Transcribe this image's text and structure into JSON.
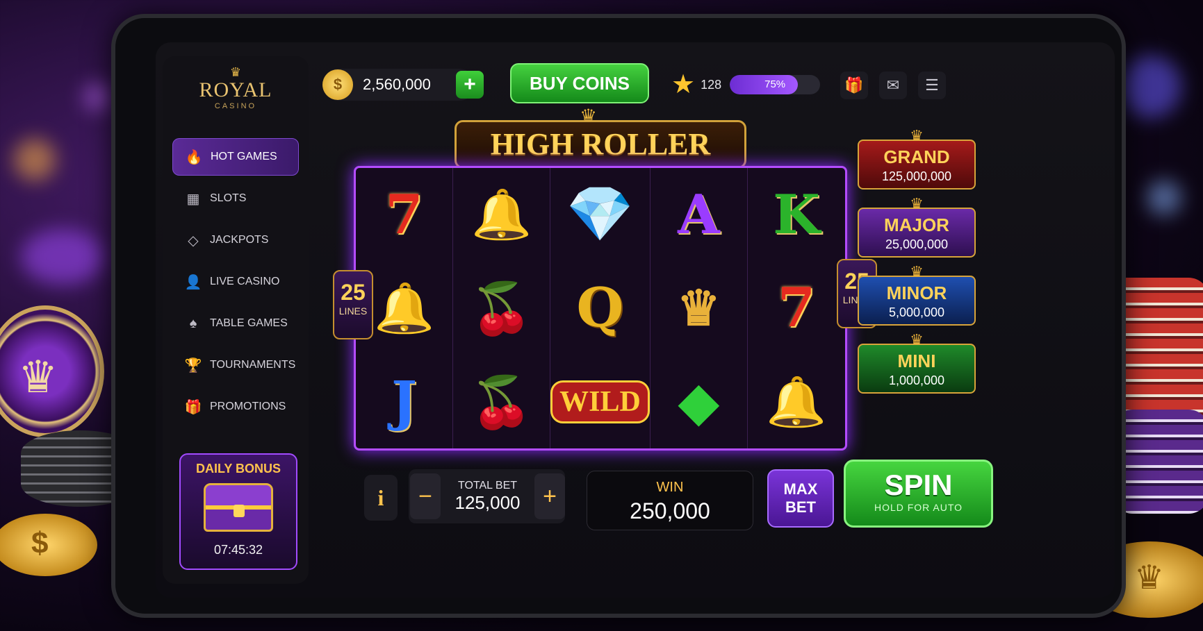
{
  "sidebar": {
    "logo": {
      "brand": "ROYAL",
      "sub": "CASINO"
    },
    "items": [
      {
        "label": "HOT GAMES",
        "icon": "flame-icon",
        "active": true
      },
      {
        "label": "SLOTS",
        "icon": "slot-machine-icon"
      },
      {
        "label": "JACKPOTS",
        "icon": "diamond-icon"
      },
      {
        "label": "LIVE CASINO",
        "icon": "person-icon"
      },
      {
        "label": "TABLE GAMES",
        "icon": "spade-icon"
      },
      {
        "label": "TOURNAMENTS",
        "icon": "trophy-icon"
      },
      {
        "label": "PROMOTIONS",
        "icon": "gift-icon"
      }
    ],
    "daily_bonus": {
      "title": "DAILY BONUS",
      "timer": "07:45:32"
    }
  },
  "topbar": {
    "coins": "2,560,000",
    "buy_coins": "BUY COINS",
    "level": "128",
    "xp_percent_label": "75%",
    "xp_fraction": 0.75
  },
  "game": {
    "title": "HIGH ROLLER",
    "lines_left": {
      "n": "25",
      "t": "LINES"
    },
    "lines_right": {
      "n": "25",
      "t": "LINES"
    },
    "reels": [
      [
        "7",
        "bell",
        "diamond",
        "A",
        "K"
      ],
      [
        "bell-dollar",
        "cherry",
        "Q",
        "crown",
        "7"
      ],
      [
        "J",
        "cherry",
        "WILD",
        "emerald",
        "bell"
      ]
    ]
  },
  "jackpots": [
    {
      "name": "GRAND",
      "value": "125,000,000"
    },
    {
      "name": "MAJOR",
      "value": "25,000,000"
    },
    {
      "name": "MINOR",
      "value": "5,000,000"
    },
    {
      "name": "MINI",
      "value": "1,000,000"
    }
  ],
  "controls": {
    "info": "i",
    "total_bet_label": "TOTAL BET",
    "total_bet": "125,000",
    "win_label": "WIN",
    "win": "250,000",
    "max_bet_line1": "MAX",
    "max_bet_line2": "BET",
    "spin": "SPIN",
    "spin_sub": "HOLD FOR AUTO"
  },
  "colors": {
    "accent_purple": "#7f4ad1",
    "spin_green": "#46d53f",
    "gold": "#ffd35a"
  }
}
